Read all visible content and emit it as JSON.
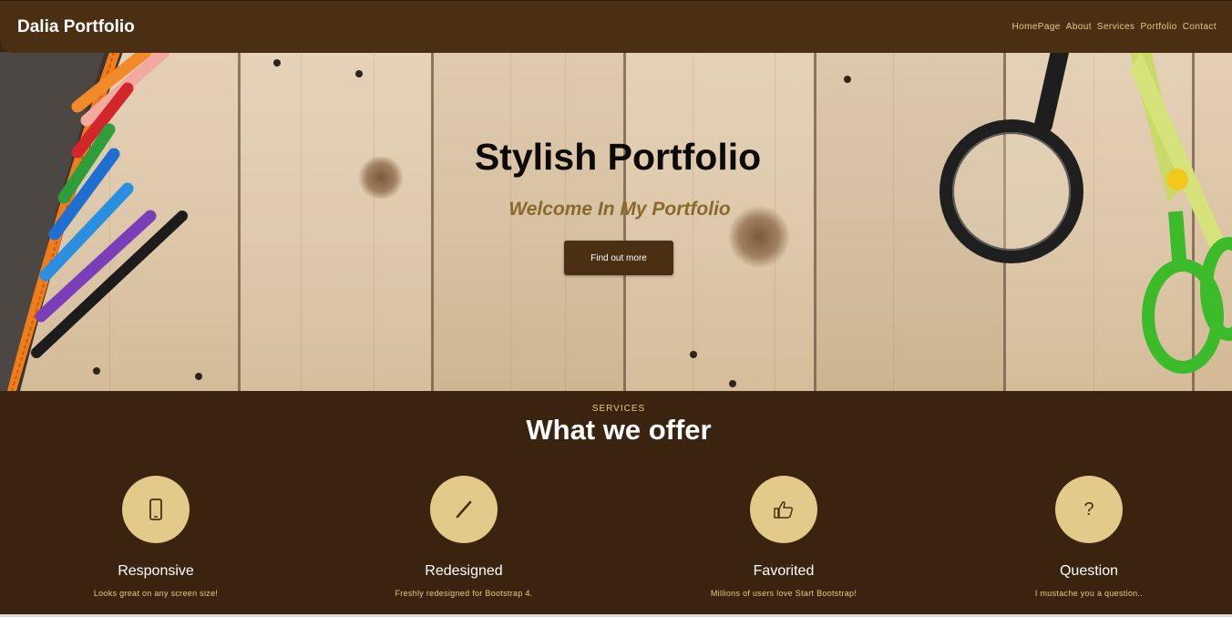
{
  "navbar": {
    "brand": "Dalia Portfolio",
    "links": [
      "HomePage",
      "About",
      "Services",
      "Portfolio",
      "Contact"
    ]
  },
  "hero": {
    "title": "Stylish Portfolio",
    "subtitle": "Welcome In My Portfolio",
    "button_label": "Find out more"
  },
  "services": {
    "label": "SERVICES",
    "title": "What we offer",
    "items": [
      {
        "icon": "mobile-phone-icon",
        "title": "Responsive",
        "description": "Looks great on any screen size!"
      },
      {
        "icon": "pencil-icon",
        "title": "Redesigned",
        "description": "Freshly redesigned for Bootstrap 4."
      },
      {
        "icon": "thumbs-up-icon",
        "title": "Favorited",
        "description": "Millions of users love Start Bootstrap!"
      },
      {
        "icon": "question-mark-icon",
        "title": "Question",
        "description": "I mustache you a question.."
      }
    ]
  },
  "colors": {
    "navbar_bg": "#4a2f12",
    "services_bg": "#3a2410",
    "accent_gold": "#e6c98a",
    "circle_bg": "#e3c98a",
    "subtitle_color": "#8a6a2b"
  }
}
